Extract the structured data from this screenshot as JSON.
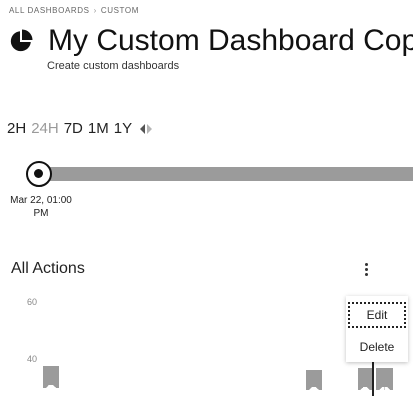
{
  "breadcrumb": {
    "root": "ALL DASHBOARDS",
    "current": "CUSTOM"
  },
  "header": {
    "icon": "pie-chart-icon",
    "title": "My Custom Dashboard Copy",
    "subtitle": "Create custom dashboards"
  },
  "time_range": {
    "options": [
      "2H",
      "24H",
      "7D",
      "1M",
      "1Y"
    ],
    "selected": "24H",
    "scroll_icon": "left-right-arrows-icon"
  },
  "timeline": {
    "date_line1": "Mar 22, 01:00",
    "date_line2": "PM"
  },
  "widget": {
    "title": "All Actions",
    "menu_icon": "kebab-menu-icon",
    "y_ticks": [
      "60",
      "40"
    ],
    "menu": {
      "items": [
        "Edit",
        "Delete"
      ],
      "focused": "Edit"
    }
  },
  "colors": {
    "bar": "#9b9b9b",
    "selected_range": "#9a9a9a",
    "text": "#222222"
  }
}
